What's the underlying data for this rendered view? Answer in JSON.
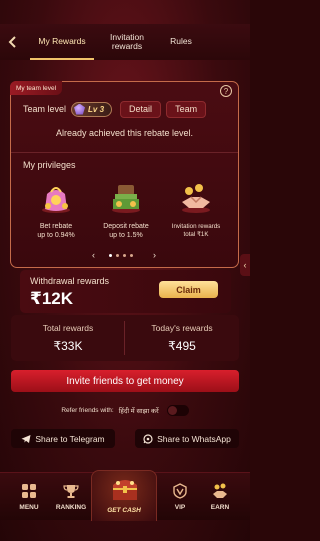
{
  "header": {
    "back_icon": "back-arrow-icon",
    "tabs": [
      {
        "label": "My Rewards",
        "active": true
      },
      {
        "label": "Invitation rewards",
        "active": false
      },
      {
        "label": "Rules",
        "active": false
      }
    ]
  },
  "team": {
    "tag": "My team level",
    "label": "Team level",
    "level": "Lv 3",
    "detail_button": "Detail",
    "team_button": "Team",
    "status": "Already achieved this rebate level.",
    "privileges_title": "My privileges",
    "privileges": [
      {
        "line1": "Bet rebate",
        "line2": "up to 0.94%",
        "icon": "gift-bag-icon"
      },
      {
        "line1": "Deposit rebate",
        "line2": "up to 1.5%",
        "icon": "money-chest-icon"
      },
      {
        "line1": "Invitation rewards",
        "line2": "total ₹1K",
        "icon": "handshake-icon"
      }
    ],
    "carousel_dots": 4,
    "carousel_active": 0
  },
  "withdrawal": {
    "label": "Withdrawal rewards",
    "amount": "₹12K",
    "claim_button": "Claim"
  },
  "totals": {
    "total_label": "Total rewards",
    "total_value": "₹33K",
    "today_label": "Today's rewards",
    "today_value": "₹495"
  },
  "invite_button": "Invite friends to get money",
  "refer": {
    "text1": "Refer friends with:",
    "text2": "हिंदी में साझा करें",
    "toggle_on": false
  },
  "share": {
    "telegram": "Share to Telegram",
    "whatsapp": "Share to WhatsApp"
  },
  "nav": {
    "menu": "MENU",
    "ranking": "RANKING",
    "get_cash": "GET CASH",
    "vip": "VIP",
    "earn": "EARN"
  },
  "colors": {
    "accent_gold": "#f0c46a",
    "primary_red": "#d81f2c",
    "background": "#2a0608"
  }
}
